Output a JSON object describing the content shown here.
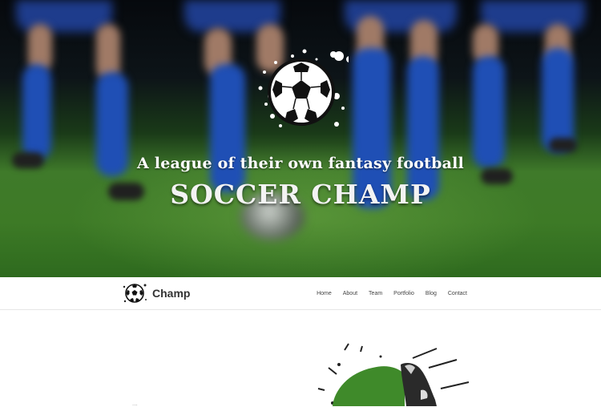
{
  "hero": {
    "tagline": "A league of their own fantasy football",
    "title": "SOCCER CHAMP"
  },
  "navbar": {
    "brand": "Champ",
    "links": [
      "Home",
      "About",
      "Team",
      "Portfolio",
      "Blog",
      "Contact"
    ]
  },
  "content": {
    "partial_text": "..."
  },
  "colors": {
    "hero_green": "#3f7a2a",
    "sock_blue": "#1f4fb5",
    "nav_text": "#444444",
    "brand_text": "#333333"
  },
  "icons": {
    "hero_logo": "soccer-ball-splash-icon",
    "brand_logo": "soccer-ball-icon"
  }
}
